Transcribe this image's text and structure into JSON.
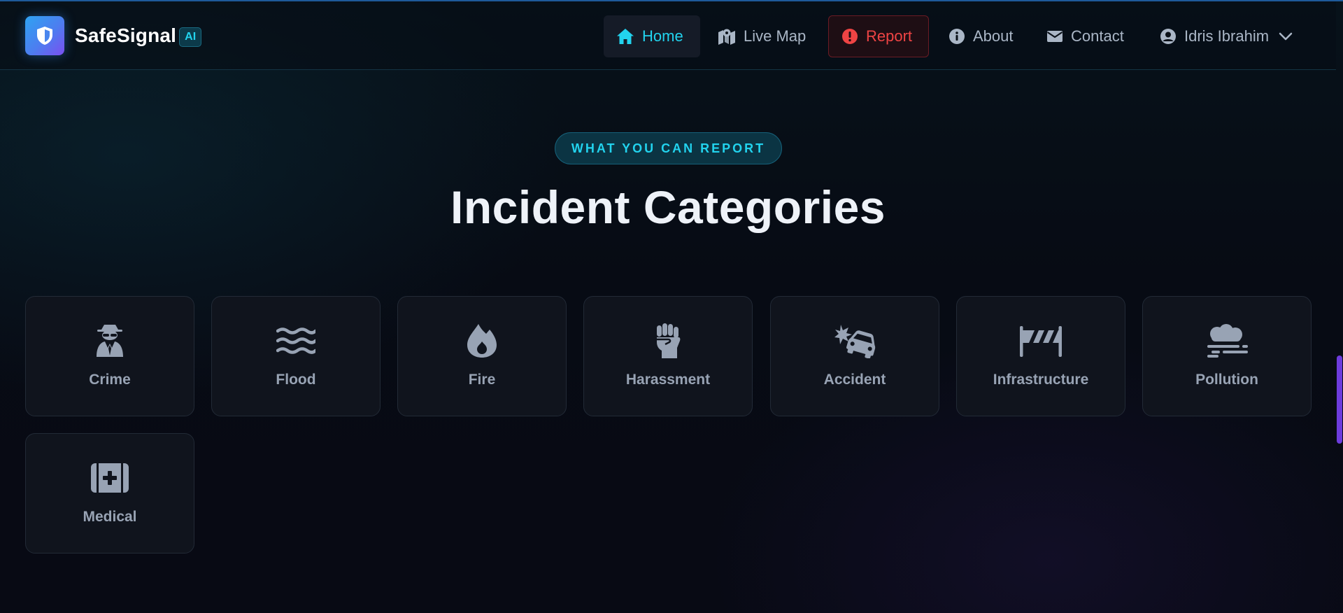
{
  "brand": {
    "name": "SafeSignal",
    "badge": "AI"
  },
  "nav": {
    "home": "Home",
    "live_map": "Live Map",
    "report": "Report",
    "about": "About",
    "contact": "Contact",
    "user_name": "Idris Ibrahim",
    "active": "Home"
  },
  "section": {
    "eyebrow": "WHAT YOU CAN REPORT",
    "title": "Incident Categories"
  },
  "categories": [
    {
      "label": "Crime",
      "icon": "user-secret-icon"
    },
    {
      "label": "Flood",
      "icon": "water-icon"
    },
    {
      "label": "Fire",
      "icon": "fire-icon"
    },
    {
      "label": "Harassment",
      "icon": "fist-raised-icon"
    },
    {
      "label": "Accident",
      "icon": "car-crash-icon"
    },
    {
      "label": "Infrastructure",
      "icon": "road-barrier-icon"
    },
    {
      "label": "Pollution",
      "icon": "smog-icon"
    },
    {
      "label": "Medical",
      "icon": "medkit-icon"
    }
  ],
  "colors": {
    "accent": "#22d3ee",
    "danger": "#ef4444",
    "background": "#070b12",
    "card": "#10141d",
    "icon": "#98a3b4",
    "scroll_indicator": "#6d3cdd"
  }
}
